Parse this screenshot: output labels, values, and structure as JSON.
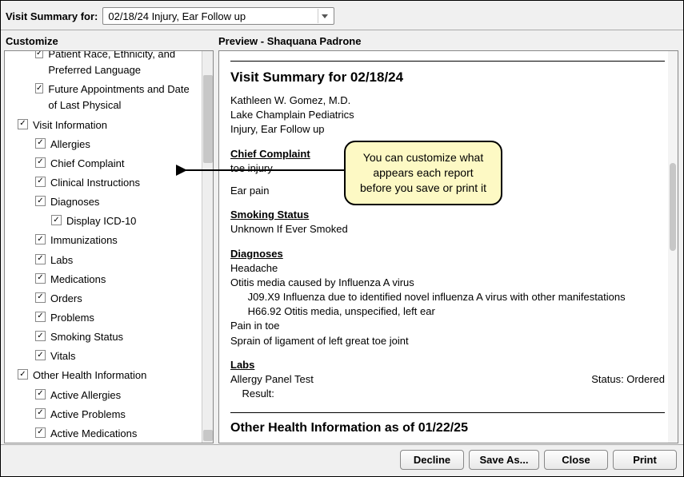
{
  "topbar": {
    "label": "Visit Summary for:",
    "selected_visit": "02/18/24 Injury, Ear Follow up"
  },
  "customize": {
    "title": "Customize",
    "items": [
      {
        "label": "Patient Race, Ethnicity, and Preferred Language",
        "indent": 1,
        "checked": true,
        "truncated": true
      },
      {
        "label": "Future Appointments and Date of Last Physical",
        "indent": 1,
        "checked": true
      },
      {
        "label": "Visit Information",
        "indent": 0,
        "checked": true
      },
      {
        "label": "Allergies",
        "indent": 1,
        "checked": true
      },
      {
        "label": "Chief Complaint",
        "indent": 1,
        "checked": true
      },
      {
        "label": "Clinical Instructions",
        "indent": 1,
        "checked": true
      },
      {
        "label": "Diagnoses",
        "indent": 1,
        "checked": true
      },
      {
        "label": "Display ICD-10",
        "indent": 2,
        "checked": true
      },
      {
        "label": "Immunizations",
        "indent": 1,
        "checked": true
      },
      {
        "label": "Labs",
        "indent": 1,
        "checked": true
      },
      {
        "label": "Medications",
        "indent": 1,
        "checked": true
      },
      {
        "label": "Orders",
        "indent": 1,
        "checked": true
      },
      {
        "label": "Problems",
        "indent": 1,
        "checked": true
      },
      {
        "label": "Smoking Status",
        "indent": 1,
        "checked": true
      },
      {
        "label": "Vitals",
        "indent": 1,
        "checked": true
      },
      {
        "label": "Other Health Information",
        "indent": 0,
        "checked": true
      },
      {
        "label": "Active Allergies",
        "indent": 1,
        "checked": true
      },
      {
        "label": "Active Problems",
        "indent": 1,
        "checked": true
      },
      {
        "label": "Active Medications",
        "indent": 1,
        "checked": true
      }
    ]
  },
  "preview": {
    "title_label": "Preview - Shaquana Padrone",
    "heading": "Visit Summary for 02/18/24",
    "provider": "Kathleen W. Gomez, M.D.",
    "practice": "Lake Champlain Pediatrics",
    "reason": "Injury, Ear Follow up",
    "chief_complaint_h": "Chief Complaint",
    "chief_complaint_1": "toe injury",
    "chief_complaint_2": "Ear pain",
    "smoking_h": "Smoking Status",
    "smoking_status": "Unknown If Ever Smoked",
    "diagnoses_h": "Diagnoses",
    "dx1": "Headache",
    "dx2": "Otitis media caused by Influenza A virus",
    "dx2a": "      J09.X9 Influenza due to identified novel influenza A virus with other manifestations",
    "dx2b": "      H66.92 Otitis media, unspecified, left ear",
    "dx3": "Pain in toe",
    "dx4": "Sprain of ligament of left great toe joint",
    "labs_h": "Labs",
    "lab_name": "Allergy Panel Test",
    "lab_status": "Status: Ordered",
    "lab_result": "    Result:",
    "other_h": "Other Health Information as of 01/22/25"
  },
  "callout": {
    "text": "You can customize what appears each report before you save or print it"
  },
  "footer": {
    "decline": "Decline",
    "save_as": "Save As...",
    "close": "Close",
    "print": "Print"
  }
}
